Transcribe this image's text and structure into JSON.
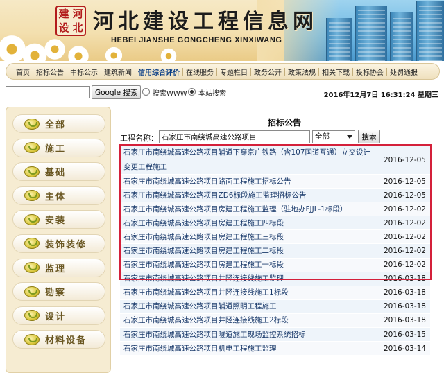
{
  "header": {
    "site_title": "河北建设工程信息网",
    "site_subtitle": "HEBEI JIANSHE GONGCHENG XINXIWANG",
    "logo_chars": [
      "建",
      "河",
      "设",
      "北"
    ]
  },
  "nav": {
    "items": [
      "首页",
      "招标公告",
      "中标公示",
      "建筑新闻",
      "信用综合评价",
      "在线服务",
      "专题栏目",
      "政务公开",
      "政策法规",
      "相关下载",
      "投标协会",
      "处罚通报"
    ],
    "active_index": 4
  },
  "search": {
    "value": "",
    "button_label": "Google 搜索",
    "options": [
      "搜索WWW",
      "本站搜索"
    ],
    "selected_index": 1,
    "datetime": "2016年12月7日 16:31:24 星期三"
  },
  "sidebar": {
    "items": [
      "全部",
      "施工",
      "基础",
      "主体",
      "安装",
      "装饰装修",
      "监理",
      "勘察",
      "设计",
      "材料设备"
    ]
  },
  "main": {
    "title": "招标公告",
    "filter_label": "工程名称：",
    "filter_value": "石家庄市南绕城高速公路项目",
    "select_value": "全部",
    "search_button": "搜索",
    "rows": [
      {
        "title": "石家庄市南绕城高速公路项目辅道下穿京广铁路（含107国道互通）立交设计变更工程施工",
        "date": "2016-12-05"
      },
      {
        "title": "石家庄市南绕城高速公路项目路面工程施工招标公告",
        "date": "2016-12-05"
      },
      {
        "title": "石家庄市南绕城高速公路项目ZD6标段施工监理招标公告",
        "date": "2016-12-05"
      },
      {
        "title": "石家庄市南绕城高速公路项目房建工程施工监理（驻地办FJJL-1标段）",
        "date": "2016-12-02"
      },
      {
        "title": "石家庄市南绕城高速公路项目房建工程施工四标段",
        "date": "2016-12-02"
      },
      {
        "title": "石家庄市南绕城高速公路项目房建工程施工三标段",
        "date": "2016-12-02"
      },
      {
        "title": "石家庄市南绕城高速公路项目房建工程施工二标段",
        "date": "2016-12-02"
      },
      {
        "title": "石家庄市南绕城高速公路项目房建工程施工一标段",
        "date": "2016-12-02"
      },
      {
        "title": "石家庄市南绕城高速公路项目井陉连接线施工监理",
        "date": "2016-03-18"
      },
      {
        "title": "石家庄市南绕城高速公路项目井陉连接线施工1标段",
        "date": "2016-03-18"
      },
      {
        "title": "石家庄市南绕城高速公路项目辅道照明工程施工",
        "date": "2016-03-18"
      },
      {
        "title": "石家庄市南绕城高速公路项目井陉连接线施工2标段",
        "date": "2016-03-18"
      },
      {
        "title": "石家庄市南绕城高速公路项目隧道施工现场监控系统招标",
        "date": "2016-03-15"
      },
      {
        "title": "石家庄市南绕城高速公路项目机电工程施工监理",
        "date": "2016-03-14"
      }
    ],
    "highlight_count": 8
  },
  "colors": {
    "highlight_border": "#d4203a",
    "link_text": "#1a3a6b",
    "sidebar_bg": "#f6ecd2"
  }
}
